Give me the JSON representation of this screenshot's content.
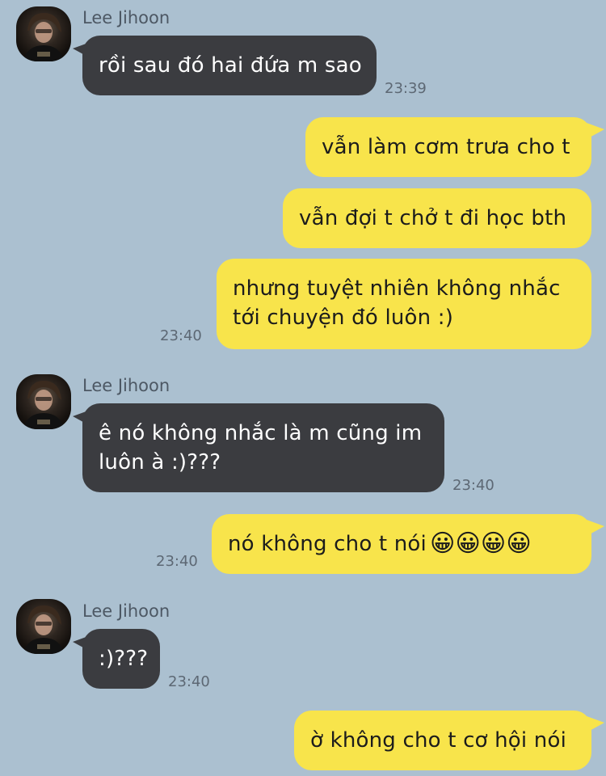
{
  "chat": {
    "contact_name": "Lee Jihoon",
    "messages": [
      {
        "from": "them",
        "text": "rồi sau đó hai đứa m sao",
        "time": "23:39"
      },
      {
        "from": "me",
        "text": "vẫn làm cơm trưa cho t"
      },
      {
        "from": "me",
        "text": "vẫn đợi t chở t đi học bth"
      },
      {
        "from": "me",
        "text": "nhưng tuyệt nhiên không nhắc tới chuyện đó luôn :)",
        "time": "23:40"
      },
      {
        "from": "them",
        "text": "ê nó không nhắc là m cũng im luôn à :)???",
        "time": "23:40"
      },
      {
        "from": "me",
        "text": "nó không cho t nói",
        "emoji": "😀😀😀😀",
        "time": "23:40"
      },
      {
        "from": "them",
        "text": ":)???",
        "time": "23:40"
      },
      {
        "from": "me",
        "text": "ờ không cho t cơ hội nói"
      }
    ]
  },
  "colors": {
    "background": "#abc0d0",
    "incoming_bubble": "#3b3c40",
    "outgoing_bubble": "#f8e44b"
  }
}
